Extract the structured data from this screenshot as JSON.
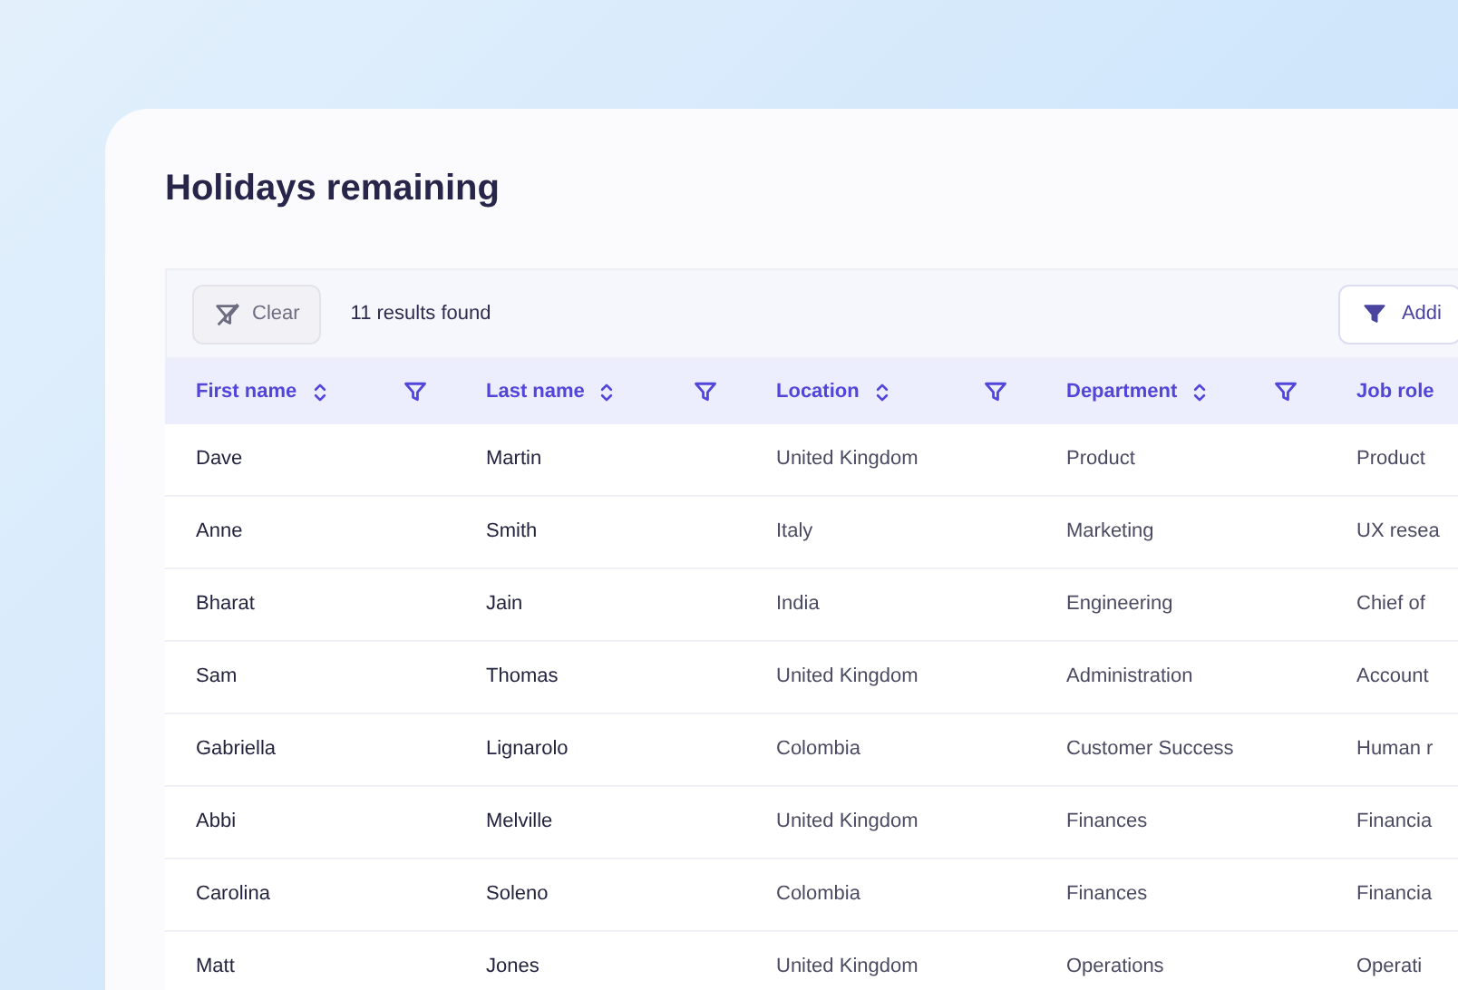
{
  "title": "Holidays remaining",
  "toolbar": {
    "clear_button": "Clear",
    "results": "11 results found",
    "add_filter_button": "Addi"
  },
  "table": {
    "columns": [
      {
        "label": "First name",
        "sortable": true,
        "filterable": true
      },
      {
        "label": "Last name",
        "sortable": true,
        "filterable": true
      },
      {
        "label": "Location",
        "sortable": true,
        "filterable": true
      },
      {
        "label": "Department",
        "sortable": true,
        "filterable": true
      },
      {
        "label": "Job role",
        "sortable": false,
        "filterable": false
      }
    ],
    "rows": [
      [
        "Dave",
        "Martin",
        "United Kingdom",
        "Product",
        "Product"
      ],
      [
        "Anne",
        "Smith",
        "Italy",
        "Marketing",
        "UX resea"
      ],
      [
        "Bharat",
        "Jain",
        "India",
        "Engineering",
        "Chief of"
      ],
      [
        "Sam",
        "Thomas",
        "United Kingdom",
        "Administration",
        "Account"
      ],
      [
        "Gabriella",
        "Lignarolo",
        "Colombia",
        "Customer Success",
        "Human r"
      ],
      [
        "Abbi",
        "Melville",
        "United Kingdom",
        "Finances",
        "Financia"
      ],
      [
        "Carolina",
        "Soleno",
        "Colombia",
        "Finances",
        "Financia"
      ],
      [
        "Matt",
        "Jones",
        "United Kingdom",
        "Operations",
        "Operati"
      ]
    ]
  }
}
